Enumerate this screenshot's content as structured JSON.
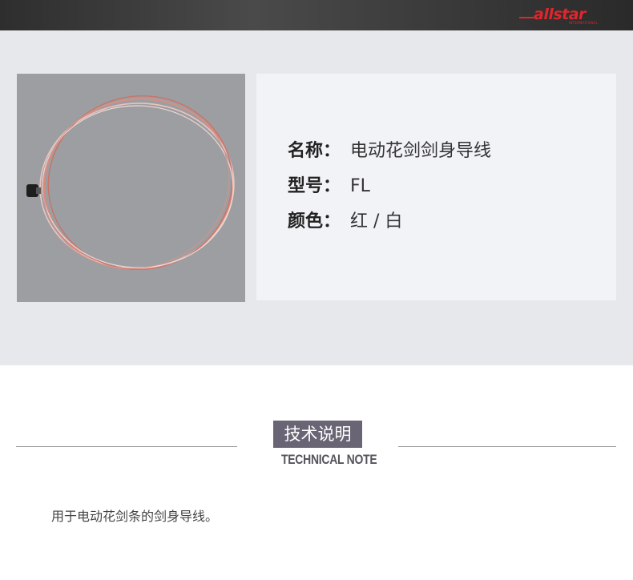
{
  "brand": {
    "logo_word": "allstar",
    "logo_sub": "INTERNATIONAL",
    "accent_color": "#e0262b"
  },
  "product": {
    "image_icon": "fencing-body-wire-coil",
    "specs": [
      {
        "label": "名称：",
        "value": "电动花剑剑身导线"
      },
      {
        "label": "型号：",
        "value": "FL"
      },
      {
        "label": "颜色：",
        "value": "红 / 白"
      }
    ]
  },
  "technical_note": {
    "title": "技术说明",
    "subtitle": "TECHNICAL NOTE",
    "title_bg_color": "#6a6575",
    "description": "用于电动花剑条的剑身导线。"
  }
}
